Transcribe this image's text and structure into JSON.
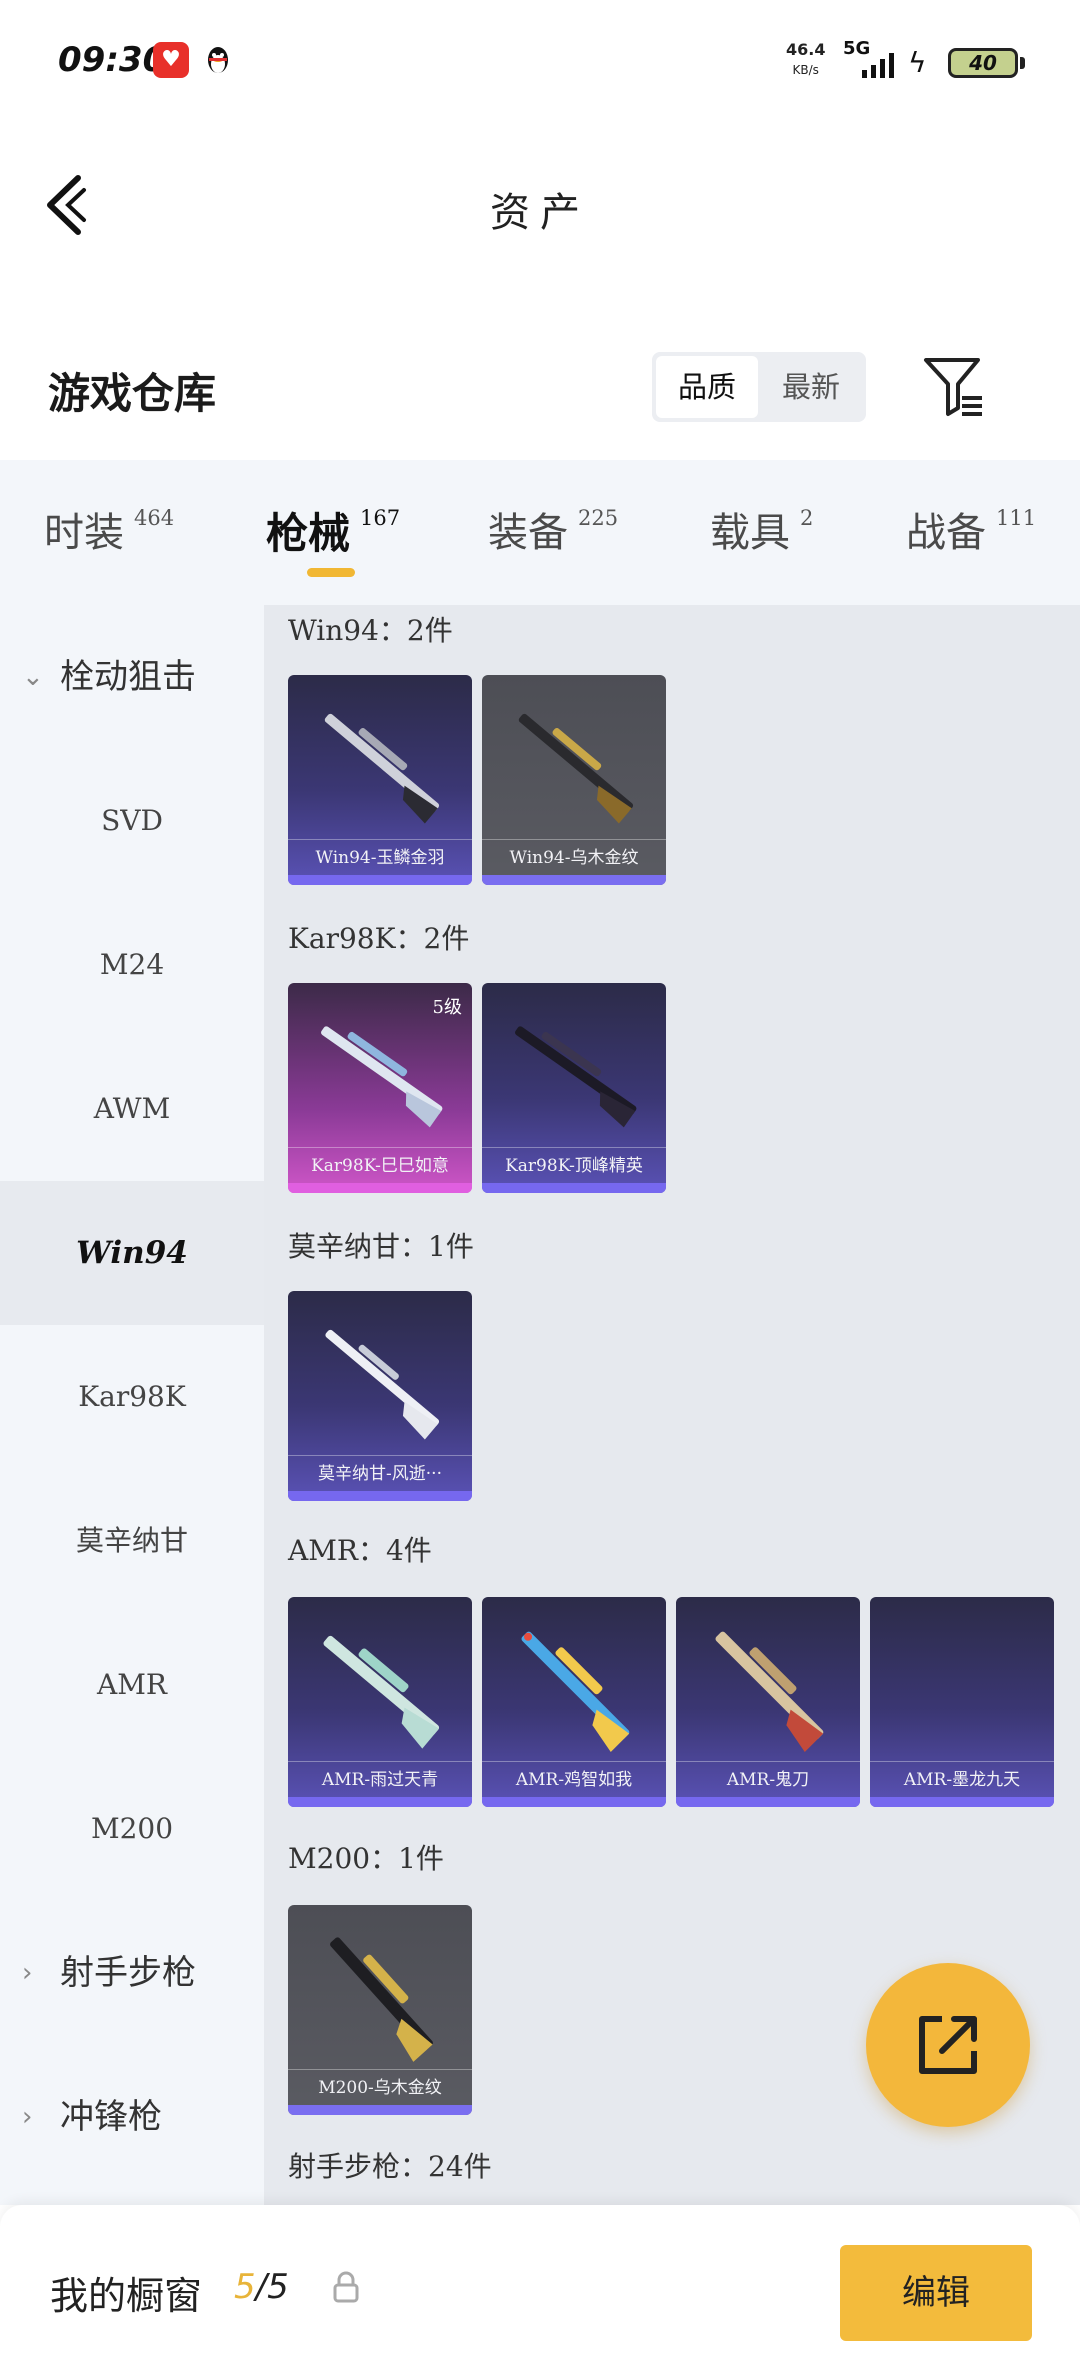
{
  "status_bar": {
    "time": "09:30",
    "net_speed": "46.4",
    "net_unit": "KB/s",
    "network": "5G",
    "battery": "40"
  },
  "header": {
    "title": "资产"
  },
  "warehouse": {
    "title": "游戏仓库",
    "sort_options": [
      "品质",
      "最新"
    ],
    "active_sort": "品质"
  },
  "tabs": [
    {
      "label": "时装",
      "count": "464"
    },
    {
      "label": "枪械",
      "count": "167",
      "active": true
    },
    {
      "label": "装备",
      "count": "225"
    },
    {
      "label": "载具",
      "count": "2"
    },
    {
      "label": "战备",
      "count": "111"
    }
  ],
  "sidebar": {
    "items": [
      {
        "label": "栓动狙击",
        "type": "category",
        "expanded": true
      },
      {
        "label": "SVD"
      },
      {
        "label": "M24"
      },
      {
        "label": "AWM"
      },
      {
        "label": "Win94",
        "active": true
      },
      {
        "label": "Kar98K"
      },
      {
        "label": "莫辛纳甘"
      },
      {
        "label": "AMR"
      },
      {
        "label": "M200"
      },
      {
        "label": "射手步枪",
        "type": "category",
        "expanded": false
      },
      {
        "label": "冲锋枪",
        "type": "category",
        "expanded": false
      }
    ]
  },
  "groups": [
    {
      "label": "Win94：2件",
      "items": [
        {
          "name": "Win94-玉鳞金羽",
          "rarity": "purple"
        },
        {
          "name": "Win94-乌木金纹",
          "rarity": "gray"
        }
      ]
    },
    {
      "label": "Kar98K：2件",
      "items": [
        {
          "name": "Kar98K-巳巳如意",
          "rarity": "pink",
          "level": "5级"
        },
        {
          "name": "Kar98K-顶峰精英",
          "rarity": "purple"
        }
      ]
    },
    {
      "label": "莫辛纳甘：1件",
      "items": [
        {
          "name": "莫辛纳甘-风逝···",
          "rarity": "purple"
        }
      ]
    },
    {
      "label": "AMR：4件",
      "items": [
        {
          "name": "AMR-雨过天青",
          "rarity": "purple"
        },
        {
          "name": "AMR-鸡智如我",
          "rarity": "purple"
        },
        {
          "name": "AMR-鬼刀",
          "rarity": "purple"
        },
        {
          "name": "AMR-墨龙九天",
          "rarity": "purple"
        }
      ]
    },
    {
      "label": "M200：1件",
      "items": [
        {
          "name": "M200-乌木金纹",
          "rarity": "gray"
        }
      ]
    },
    {
      "label": "射手步枪：24件",
      "items": []
    }
  ],
  "bottom_bar": {
    "title": "我的橱窗",
    "current": "5",
    "total": "/5",
    "edit_label": "编辑"
  },
  "colors": {
    "accent": "#f3b73b",
    "purple_card": "#3b3774",
    "pink_card": "#cf56c8",
    "gray_card": "#5a5b62"
  }
}
